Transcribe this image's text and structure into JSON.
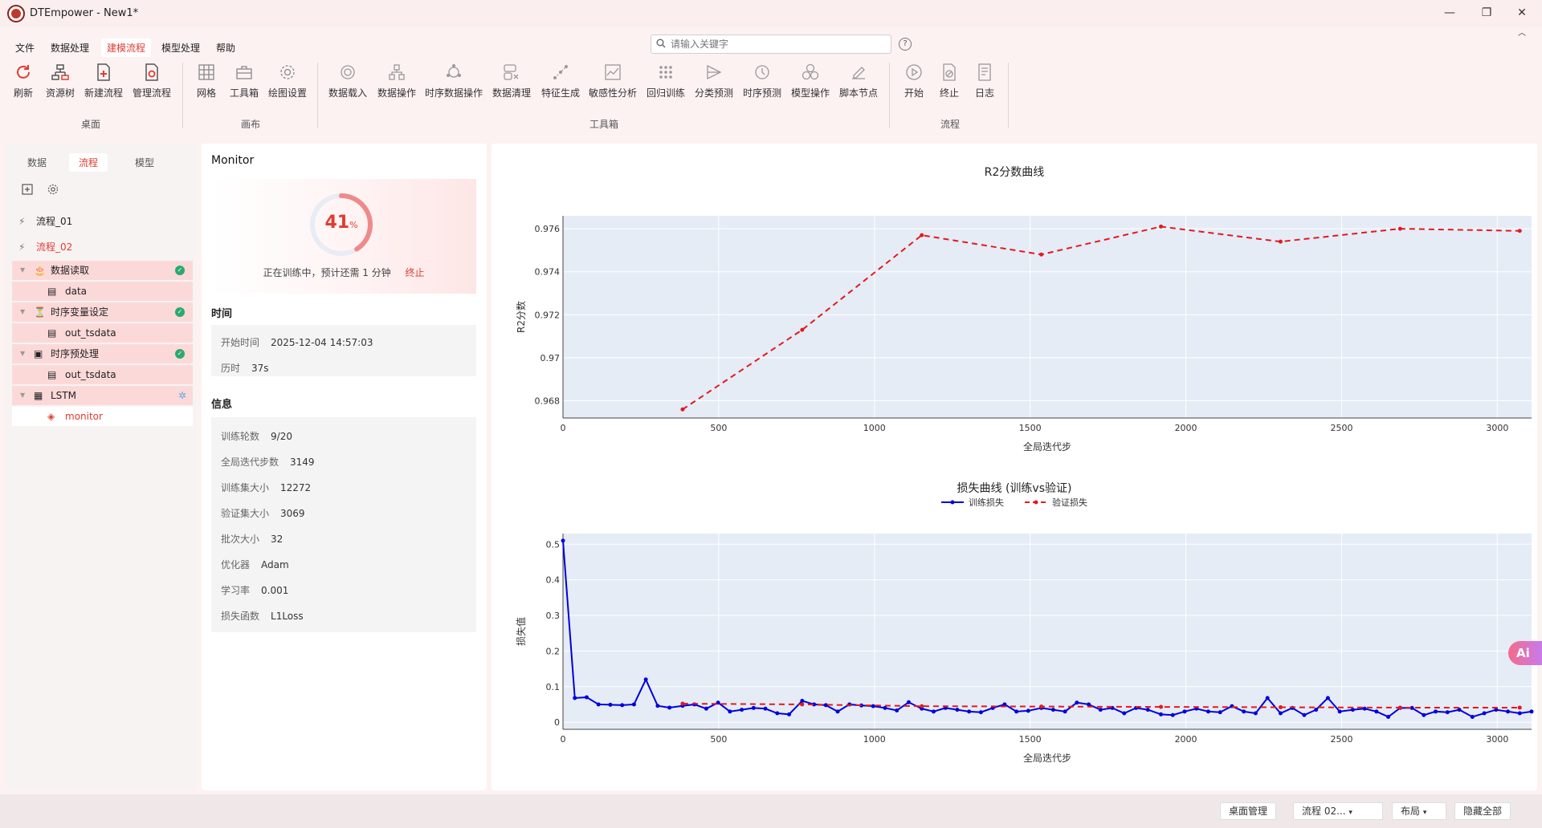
{
  "window": {
    "title": "DTEmpower - New1*"
  },
  "menu": [
    "文件",
    "数据处理",
    "建模流程",
    "模型处理",
    "帮助"
  ],
  "search": {
    "placeholder": "请输入关键字"
  },
  "ribbon": {
    "buttons": [
      "刷新",
      "资源树",
      "新建流程",
      "管理流程",
      "网格",
      "工具箱",
      "绘图设置",
      "数据载入",
      "数据操作",
      "时序数据操作",
      "数据清理",
      "特征生成",
      "敏感性分析",
      "回归训练",
      "分类预测",
      "时序预测",
      "模型操作",
      "脚本节点",
      "开始",
      "终止",
      "日志"
    ],
    "groups": [
      "桌面",
      "画布",
      "工具箱",
      "流程"
    ]
  },
  "left": {
    "tabs": [
      "数据",
      "流程",
      "模型"
    ],
    "flows": [
      "流程_01",
      "流程_02"
    ],
    "tree": [
      "数据读取",
      "data",
      "时序变量设定",
      "out_tsdata",
      "时序预处理",
      "out_tsdata",
      "LSTM",
      "monitor"
    ]
  },
  "monitor": {
    "title": "Monitor",
    "progress": 41,
    "progress_num": "41",
    "progress_unit": "%",
    "status": "正在训练中，预计还需 1 分钟",
    "stop": "终止",
    "time_header": "时间",
    "start_label": "开始时间",
    "start_value": "2025-12-04 14:57:03",
    "elapsed_label": "历时",
    "elapsed_value": "37s",
    "info_header": "信息",
    "info": [
      {
        "k": "训练轮数",
        "v": "9/20"
      },
      {
        "k": "全局迭代步数",
        "v": "3149"
      },
      {
        "k": "训练集大小",
        "v": "12272"
      },
      {
        "k": "验证集大小",
        "v": "3069"
      },
      {
        "k": "批次大小",
        "v": "32"
      },
      {
        "k": "优化器",
        "v": "Adam"
      },
      {
        "k": "学习率",
        "v": "0.001"
      },
      {
        "k": "损失函数",
        "v": "L1Loss"
      }
    ]
  },
  "chart_data": [
    {
      "type": "line",
      "title": "R2分数曲线",
      "xlabel": "全局迭代步",
      "ylabel": "R2分数",
      "xlim": [
        0,
        3110
      ],
      "ylim": [
        0.9672,
        0.9766
      ],
      "xticks": [
        0,
        500,
        1000,
        1500,
        2000,
        2500,
        3000
      ],
      "yticks": [
        0.968,
        0.97,
        0.972,
        0.974,
        0.976
      ],
      "ytick_labels": [
        "0.968",
        "0.97",
        "0.972",
        "0.974",
        "0.976"
      ],
      "series": [
        {
          "color": "#e31a1c",
          "dash": true,
          "x": [
            384,
            768,
            1152,
            1536,
            1920,
            2304,
            2688,
            3072
          ],
          "y": [
            0.9676,
            0.9713,
            0.9757,
            0.9748,
            0.9761,
            0.9754,
            0.976,
            0.9759
          ]
        }
      ]
    },
    {
      "type": "line",
      "title": "损失曲线 (训练vs验证)",
      "xlabel": "全局迭代步",
      "ylabel": "损失值",
      "xlim": [
        0,
        3110
      ],
      "ylim": [
        -0.02,
        0.53
      ],
      "xticks": [
        0,
        500,
        1000,
        1500,
        2000,
        2500,
        3000
      ],
      "yticks": [
        0,
        0.1,
        0.2,
        0.3,
        0.4,
        0.5
      ],
      "ytick_labels": [
        "0",
        "0.1",
        "0.2",
        "0.3",
        "0.4",
        "0.5"
      ],
      "series": [
        {
          "name": "训练损失",
          "color": "#0000dd",
          "dash": false,
          "x": [
            0,
            38,
            76,
            114,
            152,
            190,
            228,
            266,
            304,
            342,
            384,
            422,
            460,
            498,
            536,
            574,
            612,
            650,
            688,
            726,
            768,
            806,
            844,
            882,
            920,
            958,
            996,
            1034,
            1072,
            1110,
            1152,
            1190,
            1228,
            1266,
            1304,
            1342,
            1380,
            1418,
            1456,
            1494,
            1536,
            1574,
            1612,
            1650,
            1688,
            1726,
            1764,
            1802,
            1840,
            1878,
            1920,
            1958,
            1996,
            2034,
            2072,
            2110,
            2148,
            2186,
            2224,
            2262,
            2304,
            2342,
            2380,
            2418,
            2456,
            2494,
            2536,
            2574,
            2612,
            2650,
            2688,
            2726,
            2764,
            2802,
            2840,
            2878,
            2920,
            2958,
            2996,
            3034,
            3072,
            3110
          ],
          "y": [
            0.51,
            0.068,
            0.07,
            0.05,
            0.049,
            0.048,
            0.05,
            0.12,
            0.046,
            0.041,
            0.046,
            0.05,
            0.038,
            0.055,
            0.03,
            0.035,
            0.04,
            0.038,
            0.025,
            0.022,
            0.06,
            0.05,
            0.048,
            0.03,
            0.05,
            0.047,
            0.045,
            0.04,
            0.033,
            0.056,
            0.038,
            0.03,
            0.04,
            0.035,
            0.03,
            0.028,
            0.04,
            0.05,
            0.03,
            0.032,
            0.04,
            0.035,
            0.03,
            0.055,
            0.05,
            0.035,
            0.04,
            0.025,
            0.04,
            0.035,
            0.022,
            0.02,
            0.03,
            0.038,
            0.03,
            0.028,
            0.045,
            0.03,
            0.025,
            0.068,
            0.025,
            0.04,
            0.02,
            0.035,
            0.068,
            0.03,
            0.035,
            0.038,
            0.03,
            0.015,
            0.04,
            0.04,
            0.02,
            0.03,
            0.028,
            0.035,
            0.015,
            0.025,
            0.035,
            0.03,
            0.025,
            0.03
          ]
        },
        {
          "name": "验证损失",
          "color": "#e31a1c",
          "dash": true,
          "x": [
            384,
            768,
            1152,
            1536,
            1920,
            2304,
            2688,
            3072
          ],
          "y": [
            0.052,
            0.05,
            0.045,
            0.044,
            0.043,
            0.042,
            0.041,
            0.041
          ]
        }
      ]
    }
  ],
  "status": {
    "buttons": [
      "桌面管理",
      "流程 02...",
      "布局",
      "隐藏全部"
    ]
  },
  "ai_badge": "Ai"
}
